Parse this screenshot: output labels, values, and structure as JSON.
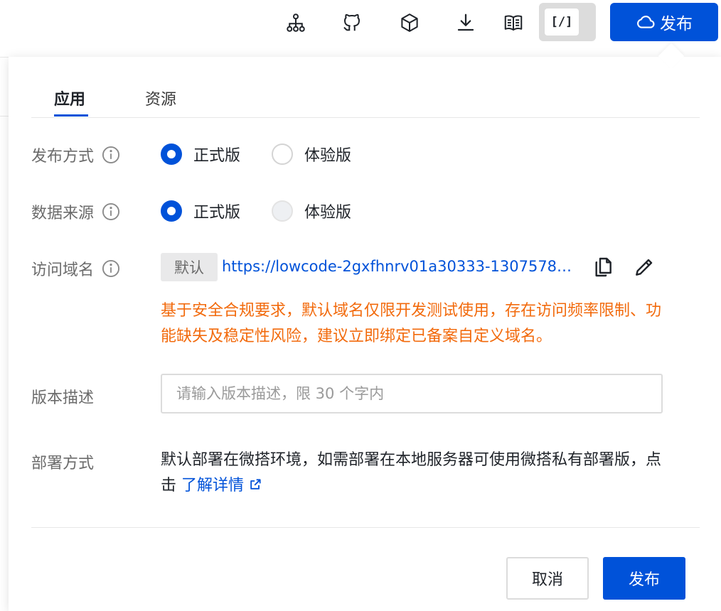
{
  "toolbar": {
    "icons": [
      "sitemap-icon",
      "github-icon",
      "cube-icon",
      "download-icon",
      "book-icon"
    ],
    "code_toggle_label": "[/]",
    "publish_label": "发布"
  },
  "tabs": [
    {
      "label": "应用",
      "active": true
    },
    {
      "label": "资源",
      "active": false
    }
  ],
  "form": {
    "publish_mode": {
      "label": "发布方式",
      "options": [
        {
          "label": "正式版",
          "checked": true
        },
        {
          "label": "体验版",
          "checked": false
        }
      ]
    },
    "data_source": {
      "label": "数据来源",
      "options": [
        {
          "label": "正式版",
          "checked": true
        },
        {
          "label": "体验版",
          "checked": false,
          "disabled": true
        }
      ]
    },
    "domain": {
      "label": "访问域名",
      "badge": "默认",
      "url": "https://lowcode-2gxfhnrv01a30333-1307578…",
      "warning": "基于安全合规要求，默认域名仅限开发测试使用，存在访问频率限制、功能缺失及稳定性风险，建议立即绑定已备案自定义域名。"
    },
    "version_desc": {
      "label": "版本描述",
      "value": "",
      "placeholder": "请输入版本描述，限 30 个字内"
    },
    "deploy": {
      "label": "部署方式",
      "text": "默认部署在微搭环境，如需部署在本地服务器可使用微搭私有部署版，点击 ",
      "link": "了解详情"
    }
  },
  "footer": {
    "cancel_label": "取消",
    "publish_label": "发布"
  },
  "colors": {
    "primary": "#0052d9",
    "warning": "#f26a0c",
    "label": "#6b6b6b",
    "border": "#dcdcdc"
  }
}
